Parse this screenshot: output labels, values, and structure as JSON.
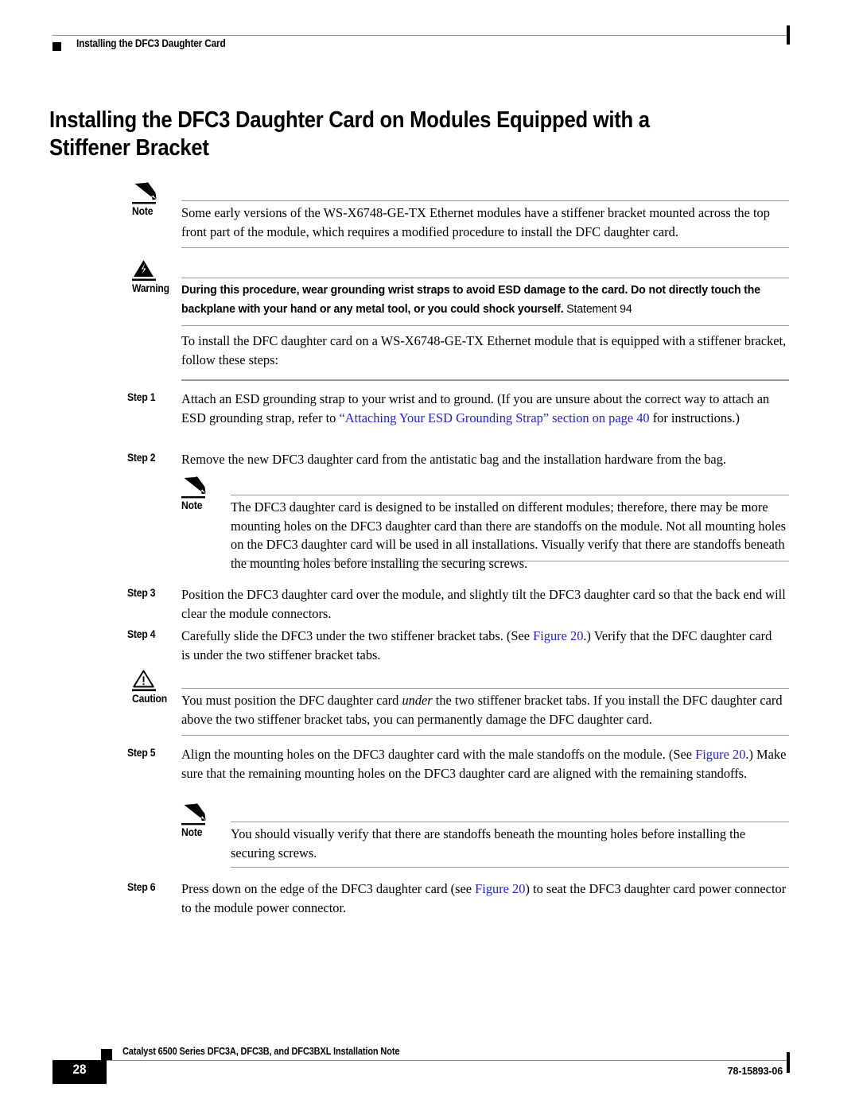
{
  "header": {
    "running_head": "Installing the DFC3 Daughter Card"
  },
  "title": {
    "text": "Installing the DFC3 Daughter Card on Modules Equipped with a Stiffener Bracket"
  },
  "colors": {
    "link": "#2222cc",
    "rule": "#9a9a9a",
    "text": "#000000"
  },
  "note1": {
    "label": "Note",
    "icon": "pencil-note-icon",
    "body": "Some early versions of the WS-X6748-GE-TX Ethernet modules have a stiffener bracket mounted across the top front part of the module, which requires a modified procedure to install the DFC daughter card."
  },
  "warning": {
    "label": "Warning",
    "icon": "lightning-warning-icon",
    "body": "During this procedure, wear grounding wrist straps to avoid ESD damage to the card. Do not directly touch the backplane with your hand or any metal tool, or you could shock yourself.",
    "statement": "Statement 94"
  },
  "intro": {
    "text": "To install the DFC daughter card on a WS-X6748-GE-TX Ethernet module that is equipped with a stiffener bracket, follow these steps:"
  },
  "steps": [
    {
      "label": "Step 1",
      "body_1": "Attach an ESD grounding strap to your wrist and to ground. (If you are unsure about the correct way to attach an ESD grounding strap, refer to ",
      "link": "“Attaching Your ESD Grounding Strap” section on page 40",
      "body_2": " for instructions.)"
    },
    {
      "label": "Step 2",
      "body_1": "Remove the new DFC3 daughter card from the antistatic bag and the installation hardware from the bag."
    },
    {
      "label": "Step 3",
      "body_1": "Position the DFC3 daughter card over the module, and slightly tilt the DFC3 daughter card so that the back end will clear the module connectors."
    },
    {
      "label": "Step 4",
      "body_1": "Carefully slide the DFC3 under the two stiffener bracket tabs. (See ",
      "link": "Figure 20",
      "body_2": ".) Verify that the DFC daughter card is under the two stiffener bracket tabs."
    },
    {
      "label": "Step 5",
      "body_1": "Align the mounting holes on the DFC3 daughter card with the male standoffs on the module. (See ",
      "link": "Figure 20",
      "body_2": ".) Make sure that the remaining mounting holes on the DFC3 daughter card are aligned with the remaining standoffs."
    },
    {
      "label": "Step 6",
      "body_1": "Press down on the edge of the DFC3 daughter card (see ",
      "link": "Figure 20",
      "body_2": ") to seat the DFC3 daughter card power connector to the module power connector."
    }
  ],
  "note2": {
    "label": "Note",
    "icon": "pencil-note-icon",
    "body": "The DFC3 daughter card is designed to be installed on different modules; therefore, there may be more mounting holes on the DFC3 daughter card than there are standoffs on the module. Not all mounting holes on the DFC3 daughter card will be used in all installations. Visually verify that there are standoffs beneath the mounting holes before installing the securing screws."
  },
  "caution": {
    "label": "Caution",
    "icon": "exclamation-caution-icon",
    "body_1": "You must position the DFC daughter card ",
    "emphasis": "under",
    "body_2": " the two stiffener bracket tabs. If you install the DFC daughter card above the two stiffener bracket tabs, you can permanently damage the DFC daughter card."
  },
  "note3": {
    "label": "Note",
    "icon": "pencil-note-icon",
    "body": "You should visually verify that there are standoffs beneath the mounting holes before installing the securing screws."
  },
  "footer": {
    "page_number": "28",
    "doc_title": "Catalyst 6500 Series DFC3A, DFC3B, and DFC3BXL Installation Note",
    "doc_id": "78-15893-06"
  }
}
